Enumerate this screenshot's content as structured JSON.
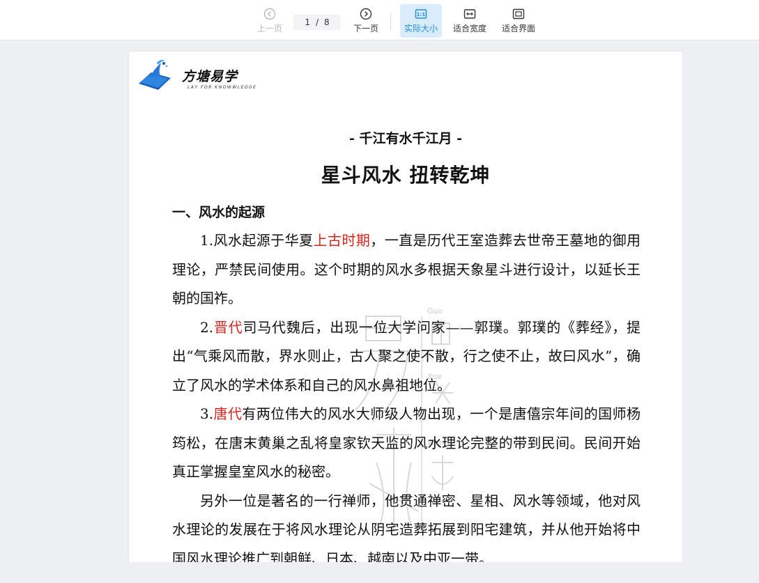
{
  "toolbar": {
    "prev_label": "上一页",
    "next_label": "下一页",
    "page_current": "1",
    "page_sep": "/",
    "page_total": "8",
    "actual_size_label": "实际大小",
    "fit_width_label": "适合宽度",
    "fit_page_label": "适合界面",
    "accent_color": "#1e8be0"
  },
  "document": {
    "logo_name": "方塘易学",
    "logo_tagline": "LAY FOR KNOWWLEDGE",
    "subtitle": "- 千江有水千江月 -",
    "title": "星斗风水  扭转乾坤",
    "section_heading": "一、风水的起源",
    "p1_a": "1.风水起源于华夏",
    "p1_red": "上古时期",
    "p1_b": "，一直是历代王室造葬去世帝王墓地的御用理论，严禁民间使用。这个时期的风水多根据天象星斗进行设计，以延长王朝的国祚。",
    "p2_a": "2.",
    "p2_red": "晋代",
    "p2_b": "司马代魏后，出现一位大学问家——郭璞。郭璞的《葬经》，提出“气乘风而散，界水则止，古人聚之使不散，行之使不止，故曰风水”，确立了风水的学术体系和自己的风水鼻祖地位。",
    "p3_a": "3.",
    "p3_red": "唐代",
    "p3_b": "有两位伟大的风水大师级人物出现，一个是唐僖宗年间的国师杨筠松，在唐末黄巢之乱将皇家钦天监的风水理论完整的带到民间。民间开始真正掌握皇室风水的秘密。",
    "p4": "另外一位是著名的一行禅师，他贯通禅密、星相、风水等领域，他对风水理论的发展在于将风水理论从阴宅造葬拓展到阳宅建筑，并从他开始将中国风水理论推广到朝鲜、日本、越南以及中亚一带。",
    "red_color": "#d9251c"
  }
}
